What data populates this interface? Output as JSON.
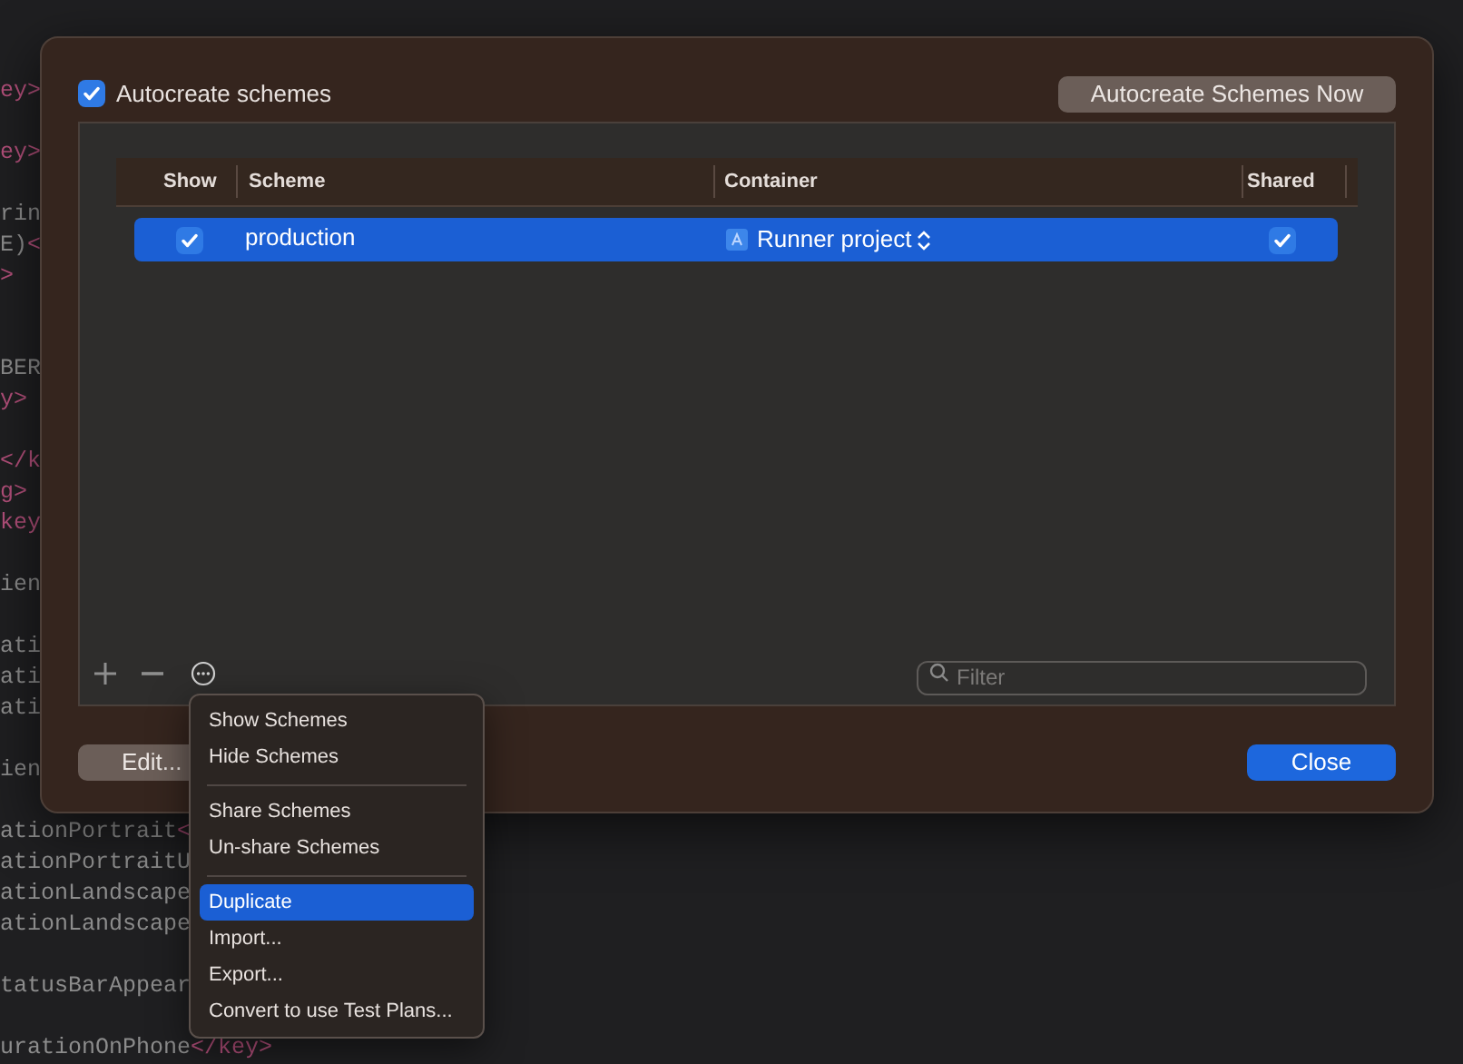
{
  "editor": {
    "lines": [
      {
        "kind": "code",
        "segments": [
          {
            "text": "ey>",
            "kind": "tag"
          }
        ]
      },
      {
        "kind": "blank"
      },
      {
        "kind": "code",
        "segments": [
          {
            "text": "ey>",
            "kind": "tag"
          }
        ]
      },
      {
        "kind": "blank"
      },
      {
        "kind": "code",
        "segments": [
          {
            "text": "rin",
            "kind": "plain"
          }
        ]
      },
      {
        "kind": "code",
        "segments": [
          {
            "text": "E)",
            "kind": "plain"
          },
          {
            "text": "<",
            "kind": "tag"
          }
        ]
      },
      {
        "kind": "code",
        "segments": [
          {
            "text": ">",
            "kind": "tag"
          }
        ]
      },
      {
        "kind": "blank"
      },
      {
        "kind": "blank"
      },
      {
        "kind": "code",
        "segments": [
          {
            "text": "BER",
            "kind": "plain"
          }
        ]
      },
      {
        "kind": "code",
        "segments": [
          {
            "text": "y>",
            "kind": "tag"
          }
        ]
      },
      {
        "kind": "blank"
      },
      {
        "kind": "code",
        "segments": [
          {
            "text": "</k",
            "kind": "tag"
          }
        ]
      },
      {
        "kind": "code",
        "segments": [
          {
            "text": "g>",
            "kind": "tag"
          }
        ]
      },
      {
        "kind": "code",
        "segments": [
          {
            "text": "key",
            "kind": "tag"
          }
        ]
      },
      {
        "kind": "blank"
      },
      {
        "kind": "code",
        "segments": [
          {
            "text": "ien",
            "kind": "plain"
          }
        ]
      },
      {
        "kind": "blank"
      },
      {
        "kind": "code",
        "segments": [
          {
            "text": "ati",
            "kind": "plain"
          }
        ]
      },
      {
        "kind": "code",
        "segments": [
          {
            "text": "ati",
            "kind": "plain"
          }
        ]
      },
      {
        "kind": "code",
        "segments": [
          {
            "text": "ati",
            "kind": "plain"
          }
        ]
      },
      {
        "kind": "blank"
      },
      {
        "kind": "code",
        "segments": [
          {
            "text": "ien",
            "kind": "plain"
          }
        ]
      },
      {
        "kind": "blank"
      },
      {
        "kind": "code",
        "segments": [
          {
            "text": "ationPortrait",
            "kind": "plain"
          },
          {
            "text": "<",
            "kind": "tag"
          }
        ]
      },
      {
        "kind": "code",
        "segments": [
          {
            "text": "ationPortraitU",
            "kind": "plain"
          }
        ]
      },
      {
        "kind": "code",
        "segments": [
          {
            "text": "ationLandscape",
            "kind": "plain"
          }
        ]
      },
      {
        "kind": "code",
        "segments": [
          {
            "text": "ationLandscape",
            "kind": "plain"
          }
        ]
      },
      {
        "kind": "blank"
      },
      {
        "kind": "code",
        "segments": [
          {
            "text": "tatusBarAppear",
            "kind": "plain"
          }
        ]
      },
      {
        "kind": "blank"
      },
      {
        "kind": "code",
        "segments": [
          {
            "text": "urationOnPhone",
            "kind": "plain"
          },
          {
            "text": "</key>",
            "kind": "tag"
          }
        ]
      }
    ]
  },
  "dialog": {
    "autocreate": {
      "label": "Autocreate schemes",
      "checked": true
    },
    "autocreate_now_button": "Autocreate Schemes Now",
    "table": {
      "columns": [
        "Show",
        "Scheme",
        "Container",
        "Shared"
      ],
      "rows": [
        {
          "show": true,
          "scheme": "production",
          "container": "Runner project",
          "shared": true,
          "selected": true
        }
      ]
    },
    "filter": {
      "placeholder": "Filter"
    },
    "edit_button": "Edit...",
    "close_button": "Close"
  },
  "menu": {
    "items": [
      {
        "kind": "item",
        "label": "Show Schemes",
        "selected": false
      },
      {
        "kind": "item",
        "label": "Hide Schemes",
        "selected": false
      },
      {
        "kind": "separator"
      },
      {
        "kind": "item",
        "label": "Share Schemes",
        "selected": false
      },
      {
        "kind": "item",
        "label": "Un-share Schemes",
        "selected": false
      },
      {
        "kind": "separator"
      },
      {
        "kind": "item",
        "label": "Duplicate",
        "selected": true
      },
      {
        "kind": "item",
        "label": "Import...",
        "selected": false
      },
      {
        "kind": "item",
        "label": "Export...",
        "selected": false
      },
      {
        "kind": "item",
        "label": "Convert to use Test Plans...",
        "selected": false
      }
    ]
  }
}
